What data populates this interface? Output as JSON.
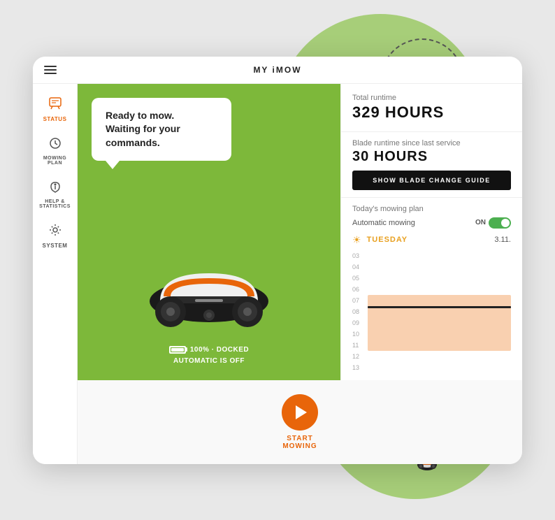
{
  "app": {
    "title": "MY iMOW",
    "menu_icon": "☰"
  },
  "sidebar": {
    "items": [
      {
        "id": "status",
        "label": "STATUS",
        "icon": "💬",
        "active": true
      },
      {
        "id": "mowing-plan",
        "label": "MOWING\nPLAN",
        "icon": "⚙"
      },
      {
        "id": "help-statistics",
        "label": "HELP &\nSTATISTICS",
        "icon": "↺"
      },
      {
        "id": "system",
        "label": "SYSTEM",
        "icon": "⚙"
      }
    ]
  },
  "mower_panel": {
    "speech_bubble_line1": "Ready to mow.",
    "speech_bubble_line2": "Waiting for your commands.",
    "battery_text": "100% · DOCKED",
    "automatic_status": "AUTOMATIC IS OFF"
  },
  "runtime": {
    "total_label": "Total runtime",
    "total_value": "329 HOURS",
    "blade_label": "Blade runtime since last service",
    "blade_value": "30 HOURS",
    "blade_btn_label": "SHOW BLADE CHANGE GUIDE"
  },
  "plan": {
    "header": "Today's mowing plan",
    "auto_label": "Automatic mowing",
    "toggle_state": "ON",
    "day_name": "TUESDAY",
    "day_date": "3.11.",
    "chart_hours": [
      "03",
      "04",
      "05",
      "06",
      "07",
      "08",
      "09",
      "10",
      "11",
      "12",
      "13"
    ],
    "chart_active_start": 4,
    "chart_active_end": 9
  },
  "controls": {
    "start_line1": "START",
    "start_line2": "MOWING"
  }
}
